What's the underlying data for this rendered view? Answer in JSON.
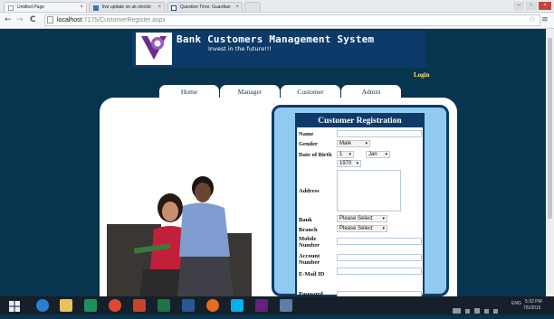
{
  "browser": {
    "tabs": [
      {
        "label": "Untitled Page",
        "active": true
      },
      {
        "label": "live update on uk electio",
        "active": false
      },
      {
        "label": "Question Time: Guardian",
        "active": false
      }
    ],
    "url_host": "localhost",
    "url_path": ":7175/CustomerRegister.aspx"
  },
  "site": {
    "title": "Bank Customers Management System",
    "tagline": "Invest in the future!!!",
    "login_link": "Login",
    "nav_tabs": [
      "Home",
      "Manager",
      "Customer",
      "Admin"
    ]
  },
  "form": {
    "heading": "Customer Registration",
    "labels": {
      "name": "Name",
      "gender": "Gender",
      "dob": "Date of Birth",
      "address": "Address",
      "bank": "Bank",
      "branch": "Branch",
      "mobile": "Mobile Number",
      "account": "Account Number",
      "email": "E-Mail ID",
      "password": "Password"
    },
    "gender_value": "Male",
    "dob_day": "1",
    "dob_month": "Jan",
    "dob_year": "1970",
    "bank_value": "Please Select",
    "branch_value": "Please Select"
  },
  "taskbar": {
    "language": "ENG",
    "time": "5:32 PM",
    "date": "7/5/2015"
  },
  "colors": {
    "page_bg": "#07344f",
    "header_bg": "#0d3a68",
    "form_border": "#91caf0",
    "login": "#ffe36e"
  },
  "icons": [
    "back-icon",
    "forward-icon",
    "reload-icon",
    "page-icon",
    "star-icon",
    "menu-icon",
    "windows-icon",
    "ie-icon",
    "explorer-icon",
    "chrome-icon"
  ]
}
